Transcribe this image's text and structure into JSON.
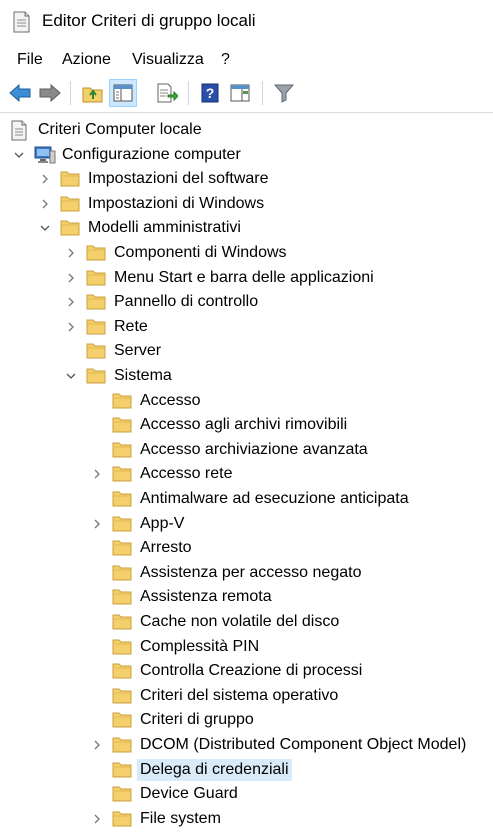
{
  "window": {
    "title": "Editor Criteri di gruppo locali",
    "icon": "policy-document-icon"
  },
  "menu": [
    "File",
    "Azione",
    "Visualizza",
    "?"
  ],
  "toolbar": [
    {
      "name": "back-button",
      "icon": "arrow-left-icon"
    },
    {
      "name": "forward-button",
      "icon": "arrow-right-icon"
    },
    {
      "name": "up-one-level-button",
      "icon": "folder-up-icon"
    },
    {
      "name": "show-hide-console-tree-button",
      "icon": "console-tree-icon",
      "pressed": true
    },
    {
      "name": "export-list-button",
      "icon": "export-list-icon"
    },
    {
      "name": "help-button",
      "icon": "help-icon"
    },
    {
      "name": "show-hide-action-pane-button",
      "icon": "action-pane-icon"
    },
    {
      "name": "filter-button",
      "icon": "filter-icon"
    }
  ],
  "colors": {
    "selection": "#d9ebf9",
    "folder": "#f5cf6b",
    "pressed": "#cce8ff"
  },
  "tree": [
    {
      "label": "Criteri Computer locale",
      "depth": 0,
      "expander": "none",
      "icon": "policy-document-icon"
    },
    {
      "label": "Configurazione computer",
      "depth": 1,
      "expander": "expanded",
      "icon": "computer-icon"
    },
    {
      "label": "Impostazioni del software",
      "depth": 2,
      "expander": "collapsed",
      "icon": "folder-icon"
    },
    {
      "label": "Impostazioni di Windows",
      "depth": 2,
      "expander": "collapsed",
      "icon": "folder-icon"
    },
    {
      "label": "Modelli amministrativi",
      "depth": 2,
      "expander": "expanded",
      "icon": "folder-icon"
    },
    {
      "label": "Componenti di Windows",
      "depth": 3,
      "expander": "collapsed",
      "icon": "folder-icon"
    },
    {
      "label": "Menu Start e barra delle applicazioni",
      "depth": 3,
      "expander": "collapsed",
      "icon": "folder-icon"
    },
    {
      "label": "Pannello di controllo",
      "depth": 3,
      "expander": "collapsed",
      "icon": "folder-icon"
    },
    {
      "label": "Rete",
      "depth": 3,
      "expander": "collapsed",
      "icon": "folder-icon"
    },
    {
      "label": "Server",
      "depth": 3,
      "expander": "none",
      "icon": "folder-icon"
    },
    {
      "label": "Sistema",
      "depth": 3,
      "expander": "expanded",
      "icon": "folder-icon"
    },
    {
      "label": "Accesso",
      "depth": 4,
      "expander": "none",
      "icon": "folder-icon"
    },
    {
      "label": "Accesso agli archivi rimovibili",
      "depth": 4,
      "expander": "none",
      "icon": "folder-icon"
    },
    {
      "label": "Accesso archiviazione avanzata",
      "depth": 4,
      "expander": "none",
      "icon": "folder-icon"
    },
    {
      "label": "Accesso rete",
      "depth": 4,
      "expander": "collapsed",
      "icon": "folder-icon"
    },
    {
      "label": "Antimalware ad esecuzione anticipata",
      "depth": 4,
      "expander": "none",
      "icon": "folder-icon"
    },
    {
      "label": "App-V",
      "depth": 4,
      "expander": "collapsed",
      "icon": "folder-icon"
    },
    {
      "label": "Arresto",
      "depth": 4,
      "expander": "none",
      "icon": "folder-icon"
    },
    {
      "label": "Assistenza per accesso negato",
      "depth": 4,
      "expander": "none",
      "icon": "folder-icon"
    },
    {
      "label": "Assistenza remota",
      "depth": 4,
      "expander": "none",
      "icon": "folder-icon"
    },
    {
      "label": "Cache non volatile del disco",
      "depth": 4,
      "expander": "none",
      "icon": "folder-icon"
    },
    {
      "label": "Complessità PIN",
      "depth": 4,
      "expander": "none",
      "icon": "folder-icon"
    },
    {
      "label": "Controlla Creazione di processi",
      "depth": 4,
      "expander": "none",
      "icon": "folder-icon"
    },
    {
      "label": "Criteri del sistema operativo",
      "depth": 4,
      "expander": "none",
      "icon": "folder-icon"
    },
    {
      "label": "Criteri di gruppo",
      "depth": 4,
      "expander": "none",
      "icon": "folder-icon"
    },
    {
      "label": "DCOM (Distributed Component Object Model)",
      "depth": 4,
      "expander": "collapsed",
      "icon": "folder-icon"
    },
    {
      "label": "Delega di credenziali",
      "depth": 4,
      "expander": "none",
      "icon": "folder-icon",
      "selected": true
    },
    {
      "label": "Device Guard",
      "depth": 4,
      "expander": "none",
      "icon": "folder-icon"
    },
    {
      "label": "File system",
      "depth": 4,
      "expander": "collapsed",
      "icon": "folder-icon"
    }
  ]
}
